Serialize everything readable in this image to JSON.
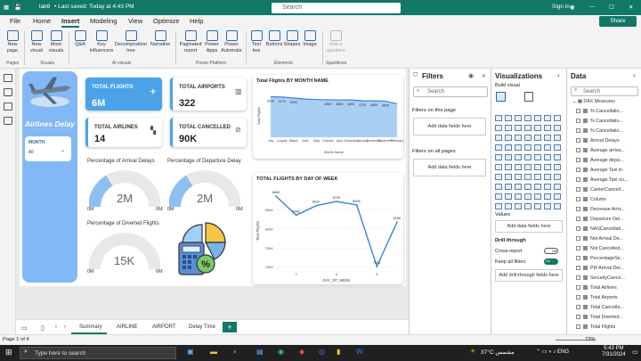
{
  "titlebar": {
    "file": "lab6",
    "saved": "• Last saved: Today at 4:43 PM",
    "search_placeholder": "Search",
    "user": "Sign in"
  },
  "menu": [
    "File",
    "Home",
    "Insert",
    "Modeling",
    "View",
    "Optimize",
    "Help"
  ],
  "share_label": "Share",
  "ribbon": {
    "buttons": [
      "New page",
      "New visual",
      "More visuals",
      "Q&A",
      "Key influencers",
      "Decomposition tree",
      "Narrative",
      "Paginated report",
      "Power Apps",
      "Power Automate",
      "Text box",
      "Buttons",
      "Shapes",
      "Image",
      "Add a sparkline"
    ],
    "groups": [
      "Pages",
      "Visuals",
      "AI visuals",
      "Power Platform",
      "Elements",
      "Sparklines"
    ]
  },
  "report": {
    "title": "Airlines Delay",
    "slicer": {
      "label": "MONTH",
      "value": "All"
    },
    "kpis": [
      {
        "label": "TOTAL FLIGHTS",
        "value": "6M"
      },
      {
        "label": "TOTAL AIRPORTS",
        "value": "322"
      },
      {
        "label": "TOTAL AIRLINES",
        "value": "14"
      },
      {
        "label": "TOTAL CANCELLED",
        "value": "90K"
      }
    ],
    "gauges": [
      {
        "title": "Percentage of Arrival Delays",
        "value": "2M",
        "min": "0M",
        "max": "6M",
        "fraction": 0.33
      },
      {
        "title": "Percentage of Departure Delay",
        "value": "2M",
        "min": "0M",
        "max": "6M",
        "fraction": 0.33
      },
      {
        "title": "Percentage of Diverted Flights",
        "value": "15K",
        "min": "0M",
        "max": "6M",
        "fraction": 0.0
      }
    ]
  },
  "chart_data": [
    {
      "type": "area",
      "title": "Total Flights BY MONTH NAME",
      "xlabel": "Month Name",
      "ylabel": "Total Flights",
      "categories": [
        "July",
        "August",
        "March",
        "June",
        "May",
        "October",
        "April",
        "December",
        "January",
        "November",
        "September",
        "February"
      ],
      "values": [
        520,
        517,
        504,
        491,
        485,
        482,
        479,
        480,
        470,
        468,
        465,
        430
      ],
      "labels": [
        "520K",
        "517K",
        "504K",
        "",
        "",
        "486K",
        "485K",
        "480K",
        "470K",
        "468K",
        "465K",
        ""
      ],
      "ylim": [
        0,
        550
      ]
    },
    {
      "type": "line",
      "title": "TOTAL FLIGHTS BY DAY OF WEEK",
      "xlabel": "DAY_OF_WEEK",
      "ylabel": "Total Flights",
      "x": [
        1,
        2,
        3,
        4,
        5,
        6,
        7
      ],
      "values": [
        886,
        836,
        861,
        872,
        863,
        702,
        818
      ],
      "labels": [
        "886K",
        "836K",
        "861K",
        "872K",
        "863K",
        "702K",
        "818K"
      ],
      "yticks": [
        "700K",
        "750K",
        "800K",
        "850K"
      ],
      "xticks": [
        "2",
        "4",
        "6"
      ],
      "ylim": [
        690,
        900
      ]
    }
  ],
  "filters": {
    "title": "Filters",
    "search": "Search",
    "this_page": "Filters on this page",
    "all_pages": "Filters on all pages",
    "add": "Add data fields here"
  },
  "viz": {
    "title": "Visualizations",
    "build": "Build visual",
    "values": "Values",
    "add": "Add data fields here",
    "drill": "Drill through",
    "cross": "Cross-report",
    "keep": "Keep all filters",
    "off": "Off",
    "on": "On",
    "add_drill": "Add drill-through fields here"
  },
  "data": {
    "title": "Data",
    "search": "Search",
    "table": "DAX Measures",
    "fields": [
      "% Cancellatio...",
      "% Cancellatio...",
      "% Cancellatio...",
      "Arrival Delays",
      "Average arriva...",
      "Average depa...",
      "Average Taxi in",
      "Average Taxi ou...",
      "CarrierCancell...",
      "Column",
      "Decrease Arriv...",
      "Departure Del...",
      "NASCancellati...",
      "Not Arrival De...",
      "Not Cancelled...",
      "PercentageSe...",
      "PM Arrival Del...",
      "SecurityCance...",
      "Total Airlines",
      "Total Airports",
      "Total Cancella...",
      "Total Diverted...",
      "Total Flights"
    ]
  },
  "tabs": [
    "Summary",
    "AIRLINE",
    "AIRPORT",
    "Delay Time"
  ],
  "status": {
    "page": "Page 1 of 4",
    "zoom": "73%"
  },
  "taskbar": {
    "search": "Type here to search",
    "weather": "37°C  مشمس",
    "time": "5:43 PM",
    "date": "7/31/2024"
  }
}
